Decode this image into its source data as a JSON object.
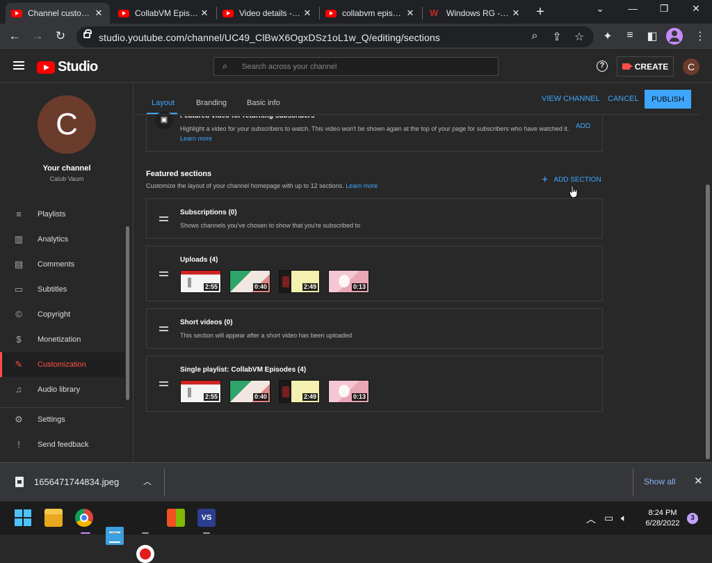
{
  "browser": {
    "tabs": [
      {
        "title": "Channel customization",
        "active": true
      },
      {
        "title": "CollabVM Episodes",
        "active": false
      },
      {
        "title": "Video details - YouTube Studio",
        "active": false
      },
      {
        "title": "collabvm episodes",
        "active": false
      },
      {
        "title": "Windows RG - Jo",
        "active": false
      }
    ],
    "url": "studio.youtube.com/channel/UC49_ClBwX6OgxDSz1oL1w_Q/editing/sections"
  },
  "header": {
    "logo_text": "Studio",
    "search_placeholder": "Search across your channel",
    "create_label": "CREATE",
    "avatar_letter": "C"
  },
  "sidebar": {
    "avatar_letter": "C",
    "your_channel": "Your channel",
    "channel_name": "Calub Vaum",
    "items": [
      {
        "label": "Playlists",
        "icon": "playlist-icon"
      },
      {
        "label": "Analytics",
        "icon": "analytics-icon"
      },
      {
        "label": "Comments",
        "icon": "comments-icon"
      },
      {
        "label": "Subtitles",
        "icon": "subtitles-icon"
      },
      {
        "label": "Copyright",
        "icon": "copyright-icon"
      },
      {
        "label": "Monetization",
        "icon": "monetization-icon"
      },
      {
        "label": "Customization",
        "icon": "customization-icon",
        "active": true
      },
      {
        "label": "Audio library",
        "icon": "audio-library-icon"
      }
    ],
    "bottom_items": [
      {
        "label": "Settings",
        "icon": "settings-icon"
      },
      {
        "label": "Send feedback",
        "icon": "feedback-icon"
      }
    ]
  },
  "main": {
    "tabs": [
      "Layout",
      "Branding",
      "Basic info"
    ],
    "actions": {
      "view_channel": "VIEW CHANNEL",
      "cancel": "CANCEL",
      "publish": "PUBLISH"
    },
    "featured_video": {
      "title": "Featured video for returning subscribers",
      "desc": "Highlight a video for your subscribers to watch. This video won't be shown again at the top of your page for subscribers who have watched it.",
      "learn_more": "Learn more",
      "add_label": "ADD"
    },
    "featured_sections": {
      "title": "Featured sections",
      "desc": "Customize the layout of your channel homepage with up to 12 sections.",
      "learn_more": "Learn more",
      "add_section": "ADD SECTION"
    },
    "sections": [
      {
        "title": "Subscriptions (0)",
        "desc": "Shows channels you've chosen to show that you're subscribed to"
      },
      {
        "title": "Uploads (4)",
        "durations": [
          "2:55",
          "0:40",
          "2:49",
          "0:13"
        ]
      },
      {
        "title": "Short videos (0)",
        "desc": "This section will appear after a short video has been uploaded"
      },
      {
        "title": "Single playlist: CollabVM Episodes (4)",
        "durations": [
          "2:55",
          "0:40",
          "2:49",
          "0:13"
        ]
      }
    ]
  },
  "downloads": {
    "file_name": "1656471744834.jpeg",
    "show_all": "Show all"
  },
  "taskbar": {
    "time": "8:24 PM",
    "date": "6/28/2022",
    "notifications": "3",
    "vs_label": "VS"
  }
}
